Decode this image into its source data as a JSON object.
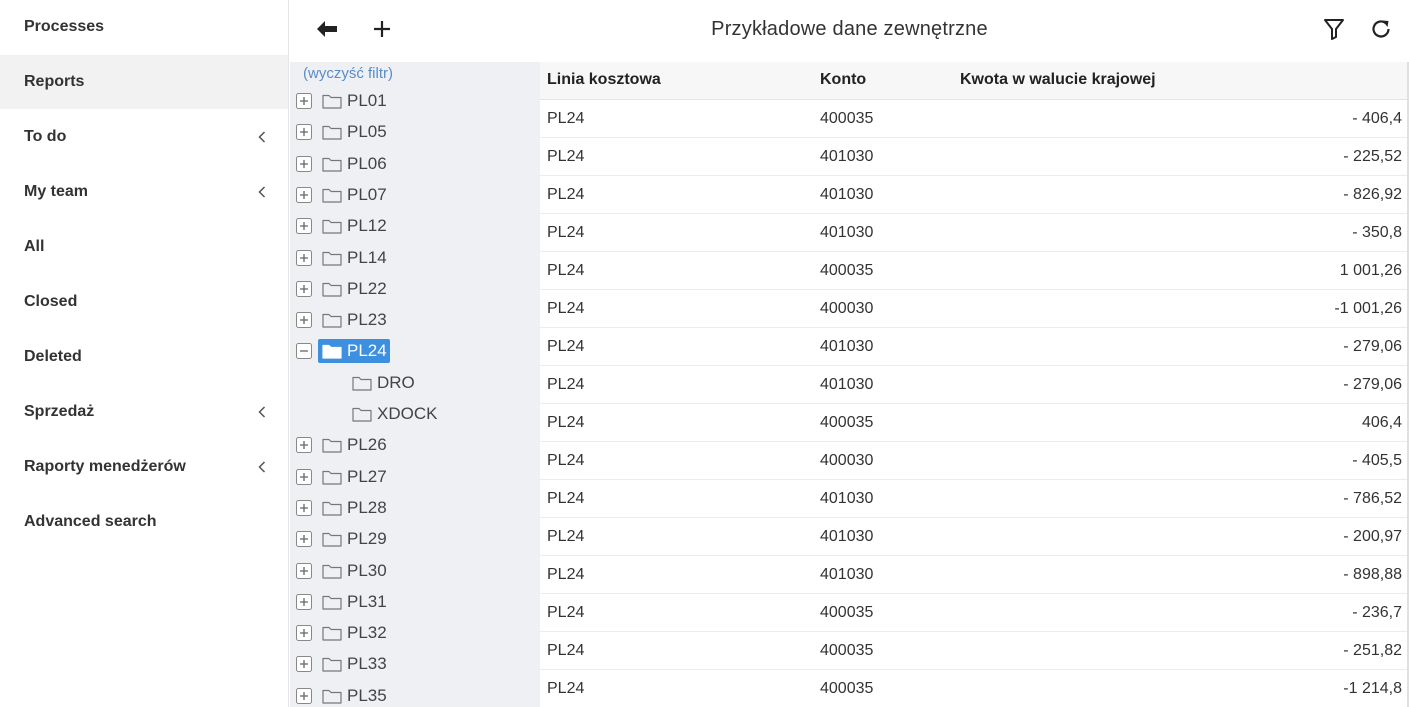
{
  "sidebar": {
    "items": [
      {
        "label": "Processes",
        "active": false,
        "expandable": false
      },
      {
        "label": "Reports",
        "active": true,
        "expandable": false
      },
      {
        "label": "To do",
        "active": false,
        "expandable": true
      },
      {
        "label": "My team",
        "active": false,
        "expandable": true
      },
      {
        "label": "All",
        "active": false,
        "expandable": false
      },
      {
        "label": "Closed",
        "active": false,
        "expandable": false
      },
      {
        "label": "Deleted",
        "active": false,
        "expandable": false
      },
      {
        "label": "Sprzedaż",
        "active": false,
        "expandable": true
      },
      {
        "label": "Raporty menedżerów",
        "active": false,
        "expandable": true
      },
      {
        "label": "Advanced search",
        "active": false,
        "expandable": false
      }
    ]
  },
  "header": {
    "title": "Przykładowe dane zewnętrzne",
    "icons": [
      "arrow-left-icon",
      "plus-icon",
      "filter-icon",
      "refresh-icon"
    ]
  },
  "tree": {
    "clear_filter": "(wyczyść filtr)",
    "nodes": [
      {
        "label": "PL01",
        "level": 0,
        "state": "collapsed",
        "selected": false
      },
      {
        "label": "PL05",
        "level": 0,
        "state": "collapsed",
        "selected": false
      },
      {
        "label": "PL06",
        "level": 0,
        "state": "collapsed",
        "selected": false
      },
      {
        "label": "PL07",
        "level": 0,
        "state": "collapsed",
        "selected": false
      },
      {
        "label": "PL12",
        "level": 0,
        "state": "collapsed",
        "selected": false
      },
      {
        "label": "PL14",
        "level": 0,
        "state": "collapsed",
        "selected": false
      },
      {
        "label": "PL22",
        "level": 0,
        "state": "collapsed",
        "selected": false
      },
      {
        "label": "PL23",
        "level": 0,
        "state": "collapsed",
        "selected": false
      },
      {
        "label": "PL24",
        "level": 0,
        "state": "expanded",
        "selected": true
      },
      {
        "label": "DRO",
        "level": 1,
        "state": "leaf",
        "selected": false
      },
      {
        "label": "XDOCK",
        "level": 1,
        "state": "leaf",
        "selected": false
      },
      {
        "label": "PL26",
        "level": 0,
        "state": "collapsed",
        "selected": false
      },
      {
        "label": "PL27",
        "level": 0,
        "state": "collapsed",
        "selected": false
      },
      {
        "label": "PL28",
        "level": 0,
        "state": "collapsed",
        "selected": false
      },
      {
        "label": "PL29",
        "level": 0,
        "state": "collapsed",
        "selected": false
      },
      {
        "label": "PL30",
        "level": 0,
        "state": "collapsed",
        "selected": false
      },
      {
        "label": "PL31",
        "level": 0,
        "state": "collapsed",
        "selected": false
      },
      {
        "label": "PL32",
        "level": 0,
        "state": "collapsed",
        "selected": false
      },
      {
        "label": "PL33",
        "level": 0,
        "state": "collapsed",
        "selected": false
      },
      {
        "label": "PL35",
        "level": 0,
        "state": "collapsed",
        "selected": false
      }
    ]
  },
  "table": {
    "columns": [
      "Linia kosztowa",
      "Konto",
      "Kwota w walucie krajowej"
    ],
    "rows": [
      [
        "PL24",
        "400035",
        "- 406,4"
      ],
      [
        "PL24",
        "401030",
        "- 225,52"
      ],
      [
        "PL24",
        "401030",
        "- 826,92"
      ],
      [
        "PL24",
        "401030",
        "- 350,8"
      ],
      [
        "PL24",
        "400035",
        "1 001,26"
      ],
      [
        "PL24",
        "400030",
        "-1 001,26"
      ],
      [
        "PL24",
        "401030",
        "- 279,06"
      ],
      [
        "PL24",
        "401030",
        "- 279,06"
      ],
      [
        "PL24",
        "400035",
        "406,4"
      ],
      [
        "PL24",
        "400030",
        "- 405,5"
      ],
      [
        "PL24",
        "401030",
        "- 786,52"
      ],
      [
        "PL24",
        "401030",
        "- 200,97"
      ],
      [
        "PL24",
        "401030",
        "- 898,88"
      ],
      [
        "PL24",
        "400035",
        "- 236,7"
      ],
      [
        "PL24",
        "400035",
        "- 251,82"
      ],
      [
        "PL24",
        "400035",
        "-1 214,8"
      ]
    ]
  },
  "colors": {
    "selected_node_bg": "#3d8fe0",
    "link": "#5b8cc9",
    "tree_bg": "#eef0f4",
    "active_nav_bg": "#f2f2f2"
  }
}
